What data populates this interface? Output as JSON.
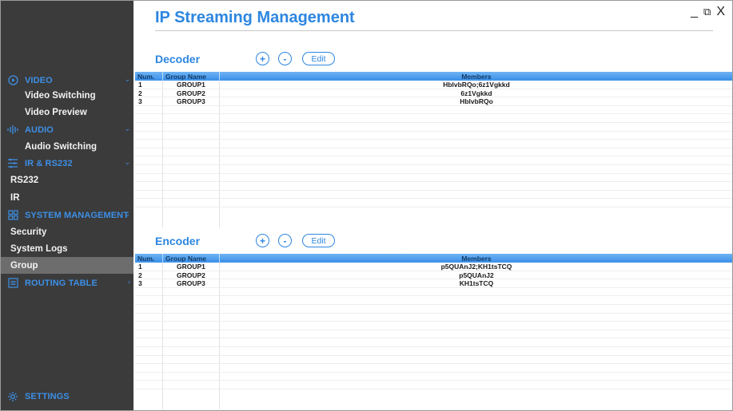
{
  "window": {
    "title": "IP Streaming Management",
    "minimize": "_",
    "restore": "⧉",
    "close": "X"
  },
  "sidebar": {
    "sections": [
      {
        "id": "video",
        "label": "VIDEO",
        "icon": "video-icon",
        "items": [
          "Video Switching",
          "Video Preview"
        ]
      },
      {
        "id": "audio",
        "label": "AUDIO",
        "icon": "audio-icon",
        "items": [
          "Audio Switching"
        ]
      },
      {
        "id": "ir",
        "label": "IR & RS232",
        "icon": "ir-icon",
        "items": [
          "RS232",
          "IR"
        ]
      },
      {
        "id": "sysmgmt",
        "label": "SYSTEM MANAGEMENT",
        "icon": "grid-icon",
        "items": [
          "Security",
          "System Logs",
          "Group"
        ]
      },
      {
        "id": "routing",
        "label": "ROUTING TABLE",
        "icon": "routing-icon",
        "items": []
      }
    ],
    "active_item": "Group",
    "settings_label": "SETTINGS"
  },
  "decoder": {
    "title": "Decoder",
    "add_label": "+",
    "remove_label": "-",
    "edit_label": "Edit",
    "columns": [
      "Num.",
      "Group Name",
      "Members"
    ],
    "rows": [
      {
        "num": "1",
        "name": "GROUP1",
        "members": "HblvbRQo;6z1Vgkkd"
      },
      {
        "num": "2",
        "name": "GROUP2",
        "members": "6z1Vgkkd"
      },
      {
        "num": "3",
        "name": "GROUP3",
        "members": "HblvbRQo"
      }
    ]
  },
  "encoder": {
    "title": "Encoder",
    "add_label": "+",
    "remove_label": "-",
    "edit_label": "Edit",
    "columns": [
      "Num.",
      "Group Name",
      "Members"
    ],
    "rows": [
      {
        "num": "1",
        "name": "GROUP1",
        "members": "p5QUAnJ2;KH1tsTCQ"
      },
      {
        "num": "2",
        "name": "GROUP2",
        "members": "p5QUAnJ2"
      },
      {
        "num": "3",
        "name": "GROUP3",
        "members": "KH1tsTCQ"
      }
    ]
  },
  "colors": {
    "accent": "#2d86e0",
    "sidebar_bg": "#3b3b3b",
    "active_bg": "#6d6d6d"
  }
}
